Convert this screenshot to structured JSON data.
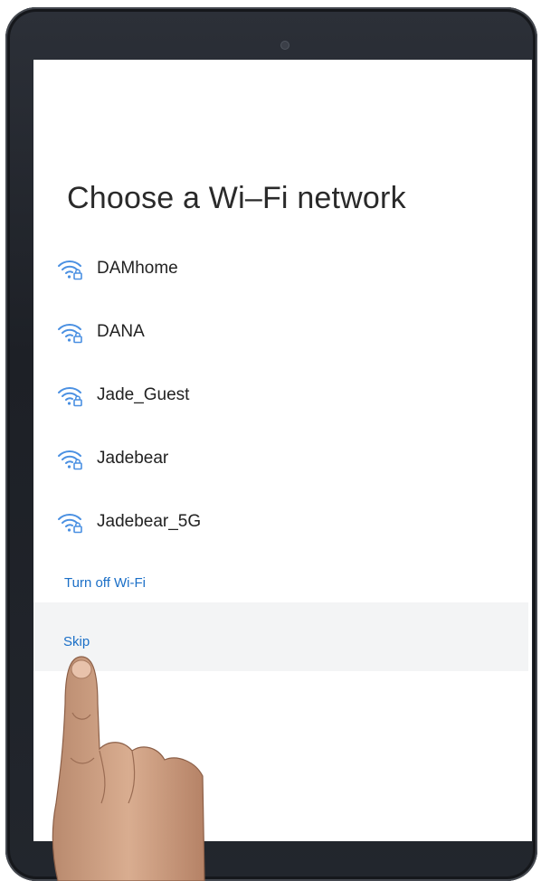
{
  "screen": {
    "title": "Choose a Wi–Fi network"
  },
  "networks": [
    {
      "name": "DAMhome",
      "icon": "wifi-locked-icon"
    },
    {
      "name": "DANA",
      "icon": "wifi-locked-icon"
    },
    {
      "name": "Jade_Guest",
      "icon": "wifi-locked-icon"
    },
    {
      "name": "Jadebear",
      "icon": "wifi-locked-icon"
    },
    {
      "name": "Jadebear_5G",
      "icon": "wifi-locked-icon"
    }
  ],
  "actions": {
    "turn_off_wifi": "Turn off Wi-Fi",
    "skip": "Skip"
  },
  "colors": {
    "accent": "#1b6fc7",
    "wifi_icon": "#4a90e2",
    "device_frame": "#1d2026"
  }
}
